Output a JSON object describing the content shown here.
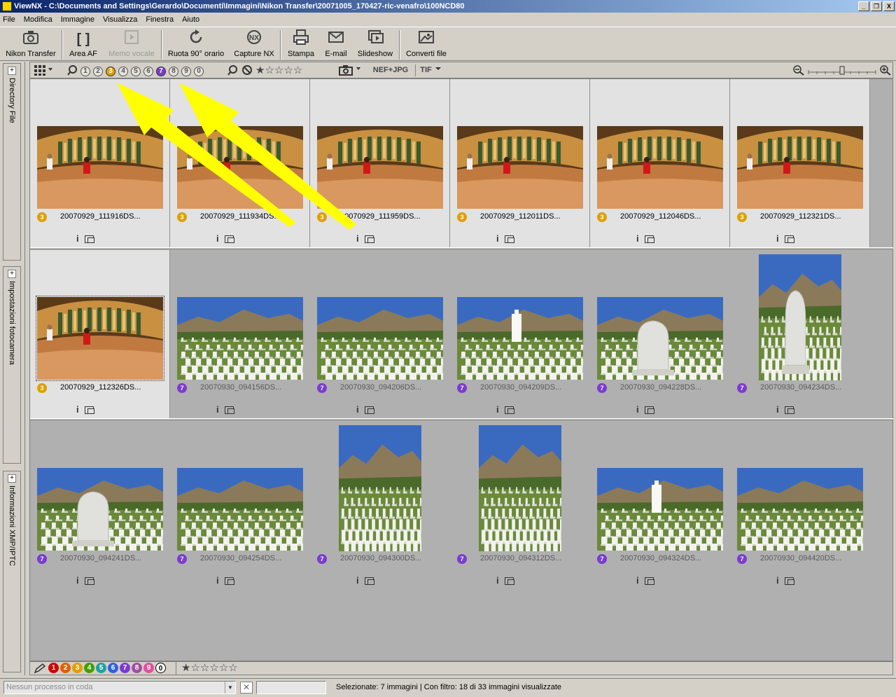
{
  "window": {
    "title": "ViewNX - C:\\Documents and Settings\\Gerardo\\Documenti\\Immagini\\Nikon Transfer\\20071005_170427-ric-venafro\\100NCD80",
    "buttons": [
      "_",
      "❐",
      "X"
    ]
  },
  "menu": [
    "File",
    "Modifica",
    "Immagine",
    "Visualizza",
    "Finestra",
    "Aiuto"
  ],
  "toolbar": {
    "nikon_transfer": "Nikon Transfer",
    "area_af": "Area AF",
    "memo_vocale": "Memo vocale",
    "ruota": "Ruota 90° orario",
    "capture_nx": "Capture NX",
    "stampa": "Stampa",
    "email": "E-mail",
    "slideshow": "Slideshow",
    "converti": "Converti file"
  },
  "side_tabs": [
    "Directory File",
    "Impostazioni fotocamera",
    "Informazioni XMP/IPTC"
  ],
  "filter_bar": {
    "labels": [
      "1",
      "2",
      "3",
      "4",
      "5",
      "6",
      "7",
      "8",
      "9",
      "0"
    ],
    "active_labels": [
      "3",
      "7"
    ],
    "format_filter": "NEF+JPG",
    "tif_filter": "TIF"
  },
  "thumbnails": [
    {
      "name": "20070929_111916DS...",
      "label": "3",
      "selected": true,
      "scene": "bar"
    },
    {
      "name": "20070929_111934DS...",
      "label": "3",
      "selected": true,
      "scene": "bar"
    },
    {
      "name": "20070929_111959DS...",
      "label": "3",
      "selected": true,
      "scene": "bar"
    },
    {
      "name": "20070929_112011DS...",
      "label": "3",
      "selected": true,
      "scene": "bar"
    },
    {
      "name": "20070929_112046DS...",
      "label": "3",
      "selected": true,
      "scene": "bar"
    },
    {
      "name": "20070929_112321DS...",
      "label": "3",
      "selected": true,
      "scene": "bar"
    },
    {
      "name": "20070929_112326DS...",
      "label": "3",
      "selected": true,
      "scene": "bar"
    },
    {
      "name": "20070930_094156DS...",
      "label": "7",
      "selected": false,
      "scene": "cemetery"
    },
    {
      "name": "20070930_094206DS...",
      "label": "7",
      "selected": false,
      "scene": "cemetery"
    },
    {
      "name": "20070930_094209DS...",
      "label": "7",
      "selected": false,
      "scene": "cemetery"
    },
    {
      "name": "20070930_094228DS...",
      "label": "7",
      "selected": false,
      "scene": "cemetery"
    },
    {
      "name": "20070930_094234DS...",
      "label": "7",
      "selected": false,
      "scene": "cemetery"
    },
    {
      "name": "20070930_094241DS...",
      "label": "7",
      "selected": false,
      "scene": "cemetery"
    },
    {
      "name": "20070930_094254DS...",
      "label": "7",
      "selected": false,
      "scene": "cemetery"
    },
    {
      "name": "20070930_094300DS...",
      "label": "7",
      "selected": false,
      "scene": "cemetery"
    },
    {
      "name": "20070930_094312DS...",
      "label": "7",
      "selected": false,
      "scene": "cemetery"
    },
    {
      "name": "20070930_094324DS...",
      "label": "7",
      "selected": false,
      "scene": "cemetery"
    },
    {
      "name": "20070930_094420DS...",
      "label": "7",
      "selected": false,
      "scene": "cemetery"
    }
  ],
  "label_bar": {
    "labels": [
      "1",
      "2",
      "3",
      "4",
      "5",
      "6",
      "7",
      "8",
      "9",
      "0"
    ],
    "colors": [
      "#d00000",
      "#e06000",
      "#e0a000",
      "#40a000",
      "#20a0a0",
      "#3060e0",
      "#7a3cd0",
      "#a050a0",
      "#e050a0",
      "#ffffff"
    ]
  },
  "status": {
    "process": "Nessun processo in coda",
    "summary": "Selezionate: 7 immagini | Con filtro: 18 di 33 immagini visualizzate"
  },
  "colors": {
    "label3": "#e0a000",
    "label7": "#7a3cd0",
    "annotation_arrow": "#ffff00"
  }
}
